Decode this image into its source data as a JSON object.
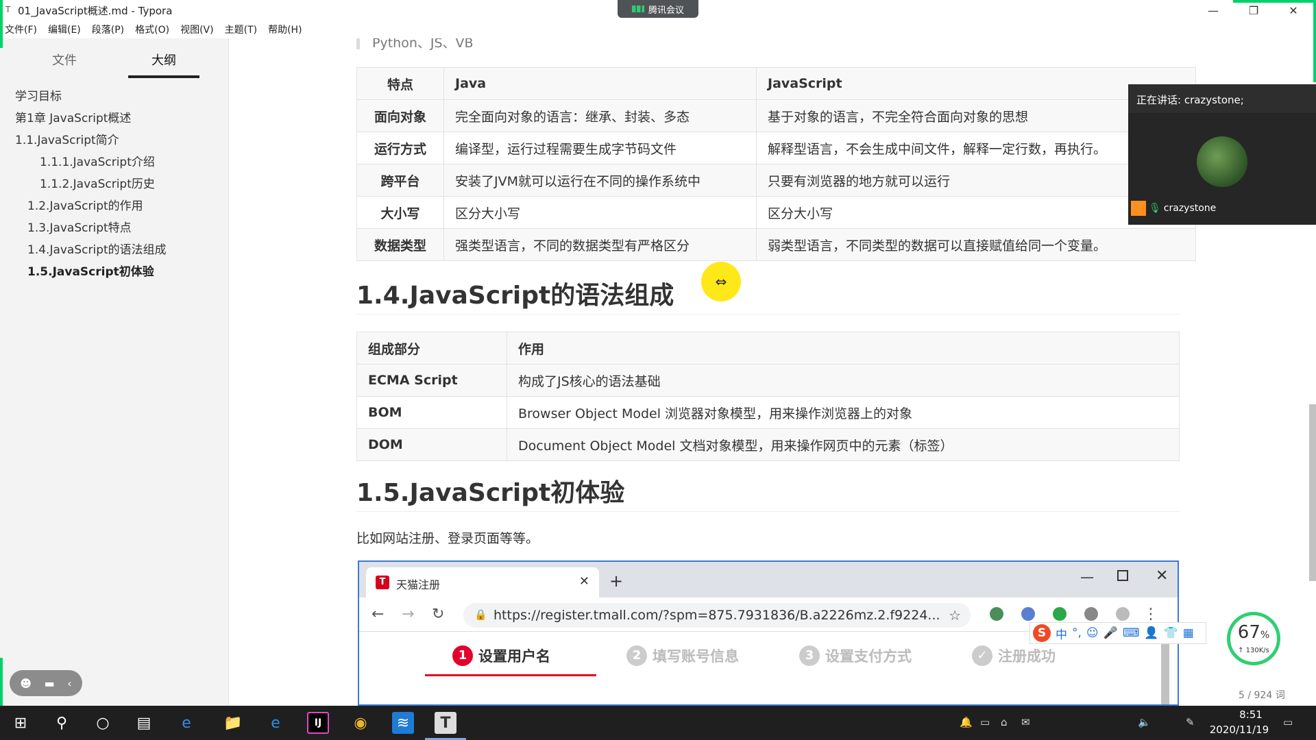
{
  "window": {
    "app_icon": "T",
    "title": "01_JavaScript概述.md - Typora",
    "minimize": "—",
    "restore": "❐",
    "close": "✕",
    "meeting_indicator": "腾讯会议"
  },
  "menu": [
    "文件(F)",
    "编辑(E)",
    "段落(P)",
    "格式(O)",
    "视图(V)",
    "主题(T)",
    "帮助(H)"
  ],
  "sidebar": {
    "tabs": [
      {
        "label": "文件",
        "active": false
      },
      {
        "label": "大纲",
        "active": true
      }
    ],
    "outline": [
      {
        "label": "学习目标",
        "level": 1
      },
      {
        "label": "第1章 JavaScript概述",
        "level": 1
      },
      {
        "label": "1.1.JavaScript简介",
        "level": 1
      },
      {
        "label": "1.1.1.JavaScript介绍",
        "level": 3
      },
      {
        "label": "1.1.2.JavaScript历史",
        "level": 3
      },
      {
        "label": "1.2.JavaScript的作用",
        "level": 2
      },
      {
        "label": "1.3.JavaScript特点",
        "level": 2
      },
      {
        "label": "1.4.JavaScript的语法组成",
        "level": 2
      },
      {
        "label": "1.5.JavaScript初体验",
        "level": 2,
        "active": true
      }
    ],
    "collapse_icon": "‹",
    "source_icon": "</>"
  },
  "document": {
    "partial_top_line": "Python、JS、VB",
    "compare_table": {
      "headers": [
        "特点",
        "Java",
        "JavaScript"
      ],
      "rows": [
        [
          "面向对象",
          "完全面向对象的语言：继承、封装、多态",
          "基于对象的语言，不完全符合面向对象的思想"
        ],
        [
          "运行方式",
          "编译型，运行过程需要生成字节码文件",
          "解释型语言，不会生成中间文件，解释一定行数，再执行。"
        ],
        [
          "跨平台",
          "安装了JVM就可以运行在不同的操作系统中",
          "只要有浏览器的地方就可以运行"
        ],
        [
          "大小写",
          "区分大小写",
          "区分大小写"
        ],
        [
          "数据类型",
          "强类型语言，不同的数据类型有严格区分",
          "弱类型语言，不同类型的数据可以直接赋值给同一个变量。"
        ]
      ]
    },
    "heading_syntax": "1.4.JavaScript的语法组成",
    "syntax_table": {
      "headers": [
        "组成部分",
        "作用"
      ],
      "rows": [
        [
          "ECMA Script",
          "构成了JS核心的语法基础"
        ],
        [
          "BOM",
          "Browser Object Model 浏览器对象模型，用来操作浏览器上的对象"
        ],
        [
          "DOM",
          "Document Object Model 文档对象模型，用来操作网页中的元素（标签）"
        ]
      ]
    },
    "heading_first": "1.5.JavaScript初体验",
    "paragraph": "比如网站注册、登录页面等等。"
  },
  "embedded_browser": {
    "favicon": "T",
    "tab_title": "天猫注册",
    "tab_close": "✕",
    "new_tab": "+",
    "min": "—",
    "close": "✕",
    "back": "←",
    "forward": "→",
    "reload": "↻",
    "lock": "🔒",
    "url": "https://register.tmall.com/?spm=875.7931836/B.a2226mz.2.f9224...",
    "star": "☆",
    "menu": "⋮",
    "steps": [
      {
        "num": "1",
        "label": "设置用户名",
        "active": true
      },
      {
        "num": "2",
        "label": "填写账号信息",
        "active": false
      },
      {
        "num": "3",
        "label": "设置支付方式",
        "active": false
      },
      {
        "num": "✓",
        "label": "注册成功",
        "active": false
      }
    ]
  },
  "ime": {
    "logo": "S",
    "mode": "中",
    "punct": "°,",
    "emoji": "☺",
    "mic": "🎤",
    "keyboard": "⌨",
    "user": "👤",
    "shirt": "👕",
    "grid": "▦"
  },
  "speed_widget": {
    "percent": "67",
    "unit": "%",
    "rate": "↑ 130K/s"
  },
  "word_count": "5 / 924 词",
  "video_panel": {
    "speaking": "正在讲话: crazystone;",
    "participant": "crazystone",
    "mic_icon": "🎙"
  },
  "floating_pill": {
    "icons": [
      "☻",
      "▬",
      "‹"
    ]
  },
  "cursor_glyph": "⇔",
  "taskbar": {
    "start_icon": "⊞",
    "search_icon": "⚲",
    "cortana_icon": "○",
    "taskview_icon": "▤",
    "apps": [
      "e",
      "📁",
      "e",
      "IJ",
      "◉",
      "≋",
      "T"
    ],
    "tray": [
      "🔔",
      "▭",
      "⌂",
      "✉",
      "🔈",
      "✎"
    ],
    "time": "8:51",
    "date": "2020/11/19",
    "notification_icon": "▭"
  },
  "colors": {
    "accent_green": "#00d26a",
    "tmall_red": "#e4002b",
    "highlight_yellow": "#ffe81a"
  }
}
